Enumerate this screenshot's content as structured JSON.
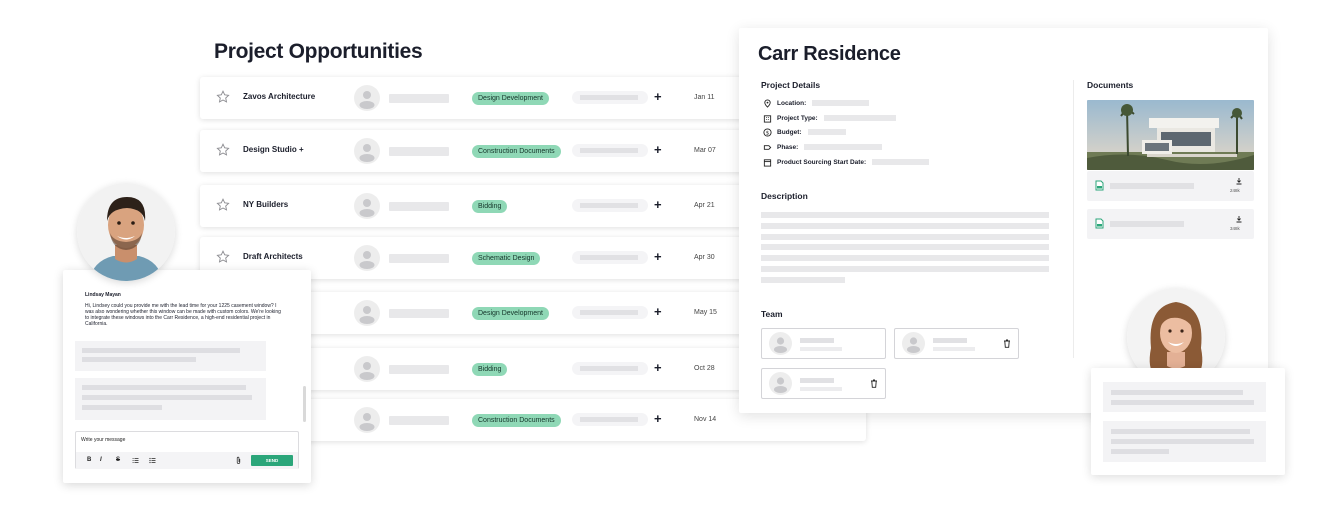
{
  "opportunities": {
    "title": "Project Opportunities",
    "rows": [
      {
        "company": "Zavos Architecture",
        "stage": "Design Development",
        "date": "Jan 11"
      },
      {
        "company": "Design Studio +",
        "stage": "Construction Documents",
        "date": "Mar 07"
      },
      {
        "company": "NY Builders",
        "stage": "Bidding",
        "date": "Apr 21"
      },
      {
        "company": "Draft Architects",
        "stage": "Schematic Design",
        "date": "Apr 30"
      },
      {
        "company": "",
        "stage": "Design Development",
        "date": "May 15"
      },
      {
        "company": "",
        "stage": "Bidding",
        "date": "Oct 28"
      },
      {
        "company": "",
        "stage": "Construction Documents",
        "date": "Nov 14"
      }
    ],
    "add_symbol": "+"
  },
  "detail": {
    "title": "Carr Residence",
    "project_details_heading": "Project Details",
    "fields": [
      {
        "label": "Location:",
        "icon": "location-pin-icon"
      },
      {
        "label": "Project Type:",
        "icon": "building-icon"
      },
      {
        "label": "Budget:",
        "icon": "dollar-icon"
      },
      {
        "label": "Phase:",
        "icon": "tag-icon"
      },
      {
        "label": "Product Sourcing Start Date:",
        "icon": "calendar-icon"
      }
    ],
    "description_heading": "Description",
    "team_heading": "Team",
    "documents_heading": "Documents",
    "documents": [
      {
        "size": "248k"
      },
      {
        "size": "348k"
      }
    ]
  },
  "chat": {
    "sender": "Lindsay Mayan",
    "message": "Hi, Lindsey could you provide me with the lead time for your 1225 casement window? I was also wondering whether this window can be made with custom colors. We're looking to integrate these windows into the Carr Residence, a high-end residential project in California.",
    "input_placeholder": "Write your message",
    "send_label": "SEND",
    "toolbar": {
      "bold": "B",
      "italic": "I",
      "strike": "S"
    }
  },
  "colors": {
    "badge_bg": "#8fd8b6",
    "send_button": "#2ba67a",
    "placeholder_bar": "#e8e8ea"
  }
}
